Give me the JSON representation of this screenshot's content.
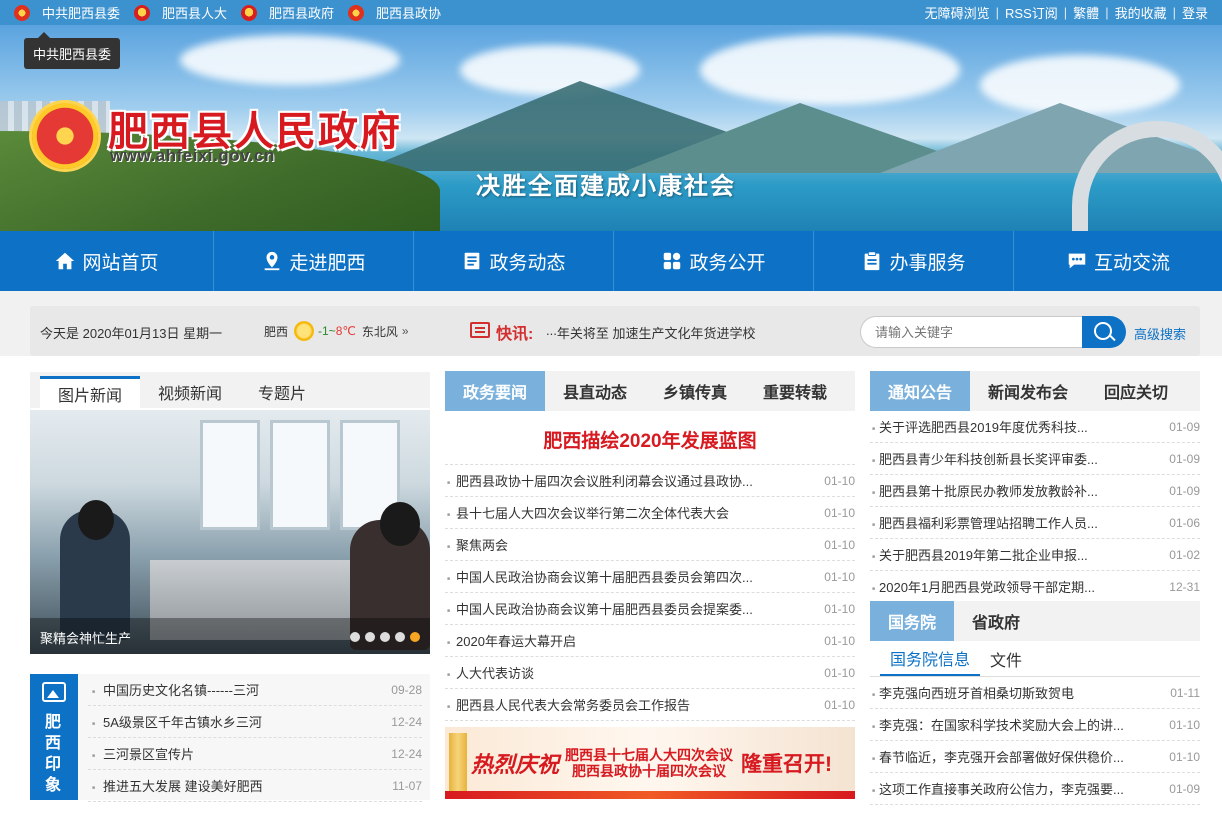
{
  "topbar": {
    "links": [
      {
        "label": "中共肥西县委",
        "emblem": "party-emblem"
      },
      {
        "label": "肥西县人大",
        "emblem": "national-emblem"
      },
      {
        "label": "肥西县政府",
        "emblem": "national-emblem"
      },
      {
        "label": "肥西县政协",
        "emblem": "cppcc-emblem"
      }
    ],
    "right_links": [
      "无障碍浏览",
      "RSS订阅",
      "繁體",
      "我的收藏",
      "登录"
    ],
    "tooltip": "中共肥西县委"
  },
  "banner": {
    "title": "肥西县人民政府",
    "url": "www.ahfeixi.gov.cn",
    "slogan": "决胜全面建成小康社会"
  },
  "nav": [
    {
      "label": "网站首页",
      "icon": "home-icon"
    },
    {
      "label": "走进肥西",
      "icon": "location-icon"
    },
    {
      "label": "政务动态",
      "icon": "document-icon"
    },
    {
      "label": "政务公开",
      "icon": "grid-icon"
    },
    {
      "label": "办事服务",
      "icon": "clipboard-icon"
    },
    {
      "label": "互动交流",
      "icon": "chat-icon"
    }
  ],
  "infobar": {
    "date": "今天是 2020年01月13日 星期一",
    "city": "肥西",
    "temp_low": "-1",
    "temp_sep": "~",
    "temp_high": "8℃",
    "wind": "东北风",
    "more": "»",
    "flash_label": "快讯:",
    "ticker": [
      "...",
      "年关将至 加速生产",
      "文化年货进学校"
    ],
    "search_placeholder": "请输入关键字",
    "advanced_search": "高级搜索"
  },
  "left": {
    "tabs": [
      "图片新闻",
      "视频新闻",
      "专题片"
    ],
    "active_tab": 0,
    "photo_caption": "聚精会神忙生产",
    "slide_count": 5,
    "active_slide": 4,
    "impression_title": "肥西印象",
    "impression_items": [
      {
        "title": "中国历史文化名镇------三河",
        "date": "09-28"
      },
      {
        "title": "5A级景区千年古镇水乡三河",
        "date": "12-24"
      },
      {
        "title": "三河景区宣传片",
        "date": "12-24"
      },
      {
        "title": "推进五大发展 建设美好肥西",
        "date": "11-07"
      }
    ]
  },
  "middle": {
    "tabs": [
      "政务要闻",
      "县直动态",
      "乡镇传真",
      "重要转载"
    ],
    "active_tab": 0,
    "headline": "肥西描绘2020年发展蓝图",
    "items": [
      {
        "title": "肥西县政协十届四次会议胜利闭幕会议通过县政协...",
        "date": "01-10"
      },
      {
        "title": "县十七届人大四次会议举行第二次全体代表大会",
        "date": "01-10"
      },
      {
        "title": "聚焦两会",
        "date": "01-10"
      },
      {
        "title": "中国人民政治协商会议第十届肥西县委员会第四次...",
        "date": "01-10"
      },
      {
        "title": "中国人民政治协商会议第十届肥西县委员会提案委...",
        "date": "01-10"
      },
      {
        "title": "2020年春运大幕开启",
        "date": "01-10"
      },
      {
        "title": "人大代表访谈",
        "date": "01-10"
      },
      {
        "title": "肥西县人民代表大会常务委员会工作报告",
        "date": "01-10"
      }
    ],
    "promo": {
      "celebrate": "热烈庆祝",
      "meeting_line1": "肥西县十七届人大四次会议",
      "meeting_line2": "肥西县政协十届四次会议",
      "grand_open": "隆重召开!"
    }
  },
  "right": {
    "tabs": [
      "通知公告",
      "新闻发布会",
      "回应关切"
    ],
    "active_tab": 0,
    "items": [
      {
        "title": "关于评选肥西县2019年度优秀科技...",
        "date": "01-09"
      },
      {
        "title": "肥西县青少年科技创新县长奖评审委...",
        "date": "01-09"
      },
      {
        "title": "肥西县第十批原民办教师发放教龄补...",
        "date": "01-09"
      },
      {
        "title": "肥西县福利彩票管理站招聘工作人员...",
        "date": "01-06"
      },
      {
        "title": "关于肥西县2019年第二批企业申报...",
        "date": "01-02"
      },
      {
        "title": "2020年1月肥西县党政领导干部定期...",
        "date": "12-31"
      }
    ],
    "tabs2": [
      "国务院",
      "省政府"
    ],
    "active_tab2": 0,
    "subtabs": [
      "国务院信息",
      "文件"
    ],
    "active_subtab": 0,
    "items2": [
      {
        "title": "李克强向西班牙首相桑切斯致贺电",
        "date": "01-11"
      },
      {
        "title": "李克强：在国家科学技术奖励大会上的讲...",
        "date": "01-10"
      },
      {
        "title": "春节临近，李克强开会部署做好保供稳价...",
        "date": "01-10"
      },
      {
        "title": "这项工作直接事关政府公信力，李克强要...",
        "date": "01-09"
      }
    ]
  },
  "colors": {
    "primary": "#0d72c6",
    "topbar": "#3c91cf",
    "tab_active": "#7ab1dc",
    "headline_red": "#d71920"
  }
}
